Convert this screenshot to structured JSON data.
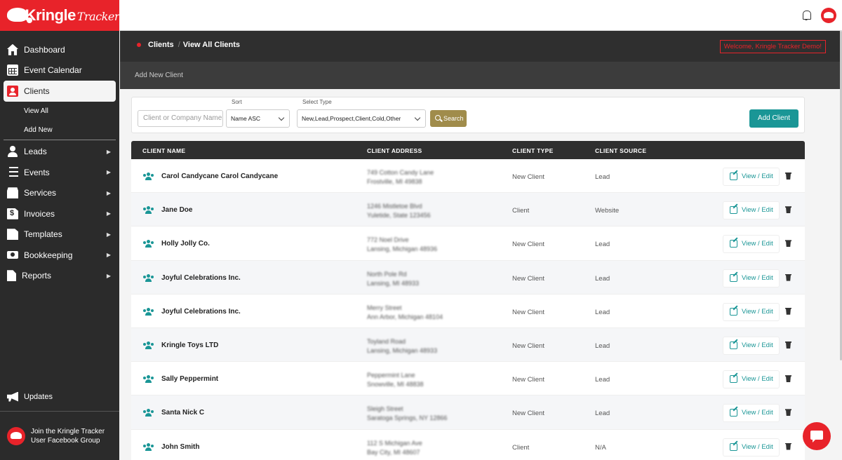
{
  "brand": {
    "name": "Kringle",
    "sub": "Tracker",
    "accent": "#e8232a",
    "teal": "#1a9696"
  },
  "sidebar": {
    "items": [
      {
        "label": "Dashboard",
        "icon": "house-icon"
      },
      {
        "label": "Event Calendar",
        "icon": "calendar-icon"
      },
      {
        "label": "Clients",
        "icon": "contact-card-icon",
        "active": true
      },
      {
        "label": "Leads",
        "icon": "user-icon",
        "expandable": true
      },
      {
        "label": "Events",
        "icon": "list-icon",
        "expandable": true
      },
      {
        "label": "Services",
        "icon": "store-icon",
        "expandable": true
      },
      {
        "label": "Invoices",
        "icon": "invoice-icon",
        "expandable": true
      },
      {
        "label": "Templates",
        "icon": "document-icon",
        "expandable": true
      },
      {
        "label": "Bookkeeping",
        "icon": "money-icon",
        "expandable": true
      },
      {
        "label": "Reports",
        "icon": "file-icon",
        "expandable": true
      }
    ],
    "clients_sub": [
      "View All",
      "Add New"
    ],
    "updates_label": "Updates",
    "facebook_line1": "Join the Kringle Tracker",
    "facebook_line2": "User Facebook Group"
  },
  "header": {
    "breadcrumb_section": "Clients",
    "breadcrumb_separator": "/",
    "breadcrumb_page": "View All Clients",
    "welcome": "Welcome, Kringle Tracker Demo!",
    "subnav": "Add New Client"
  },
  "filters": {
    "search_placeholder": "Client or Company Name",
    "sort_label": "Sort",
    "sort_value": "Name ASC",
    "type_label": "Select Type",
    "type_value": "New,Lead,Prospect,Client,Cold,Other",
    "search_button": "Search",
    "add_button": "Add Client"
  },
  "table": {
    "headers": [
      "CLIENT NAME",
      "CLIENT ADDRESS",
      "CLIENT TYPE",
      "CLIENT SOURCE"
    ],
    "action_label": "View / Edit",
    "rows": [
      {
        "name": "Carol Candycane Carol Candycane",
        "addr1": "749 Cotton Candy Lane",
        "addr2": "Frostville, MI 49838",
        "type": "New Client",
        "source": "Lead"
      },
      {
        "name": "Jane Doe",
        "addr1": "1246 Mistletoe Blvd",
        "addr2": "Yuletide, State 123456",
        "type": "Client",
        "source": "Website"
      },
      {
        "name": "Holly Jolly Co.",
        "addr1": "772 Noel Drive",
        "addr2": "Lansing, Michigan 48936",
        "type": "New Client",
        "source": "Lead"
      },
      {
        "name": "Joyful Celebrations Inc.",
        "addr1": "North Pole Rd",
        "addr2": "Lansing, MI 48933",
        "type": "New Client",
        "source": "Lead"
      },
      {
        "name": "Joyful Celebrations Inc.",
        "addr1": "Merry Street",
        "addr2": "Ann Arbor, Michigan 48104",
        "type": "New Client",
        "source": "Lead"
      },
      {
        "name": "Kringle Toys LTD",
        "addr1": "Toyland Road",
        "addr2": "Lansing, Michigan 48933",
        "type": "New Client",
        "source": "Lead"
      },
      {
        "name": "Sally Peppermint",
        "addr1": "Peppermint Lane",
        "addr2": "Snowville, MI 48838",
        "type": "New Client",
        "source": "Lead"
      },
      {
        "name": "Santa Nick C",
        "addr1": "Sleigh Street",
        "addr2": "Saratoga Springs, NY 12866",
        "type": "New Client",
        "source": "Lead"
      },
      {
        "name": "John Smith",
        "addr1": "112 S Michigan Ave",
        "addr2": "Bay City, MI 48607",
        "type": "Client",
        "source": "N/A"
      }
    ]
  }
}
